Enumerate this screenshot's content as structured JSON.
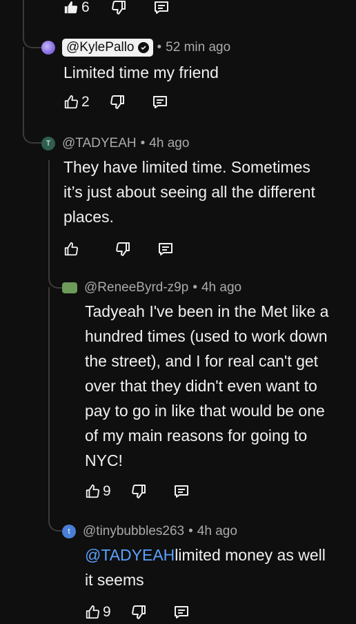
{
  "top_actions": {
    "like_count": "6"
  },
  "comments": [
    {
      "author": "@KylePallo",
      "verified": true,
      "time": "52 min ago",
      "text": "Limited time my friend",
      "like_count": "2",
      "avatar_color": "#6b5bd8"
    },
    {
      "author": "@TADYEAH",
      "avatar_letter": "T",
      "time": "4h ago",
      "text": "They have limited time. Sometimes\nit’s just about seeing all the different\nplaces.",
      "like_count": "",
      "avatar_color": "#2e5e4e"
    },
    {
      "author": "@ReneeByrd-z9p",
      "time": "4h ago",
      "text": "Tadyeah I've been in the Met like a\nhundred times (used to work down\nthe street), and I for real can't get\nover that they didn't even want to\npay to go in like that would be one\nof my main reasons for going to\nNYC!",
      "like_count": "9",
      "avatar_color": "#6d9b5a"
    },
    {
      "author": "@tinybubbles263",
      "avatar_letter": "t",
      "time": "4h ago",
      "mention": "@TADYEAH",
      "text": "limited money as well\nit seems",
      "like_count": "9",
      "avatar_color": "#4a7fd6"
    }
  ],
  "separator": "•",
  "colors": {
    "background": "#0f0f0f",
    "text": "#f1f1f1",
    "muted": "#aaaaaa",
    "mention": "#5aa2ff",
    "thread": "#3a3a3a"
  }
}
